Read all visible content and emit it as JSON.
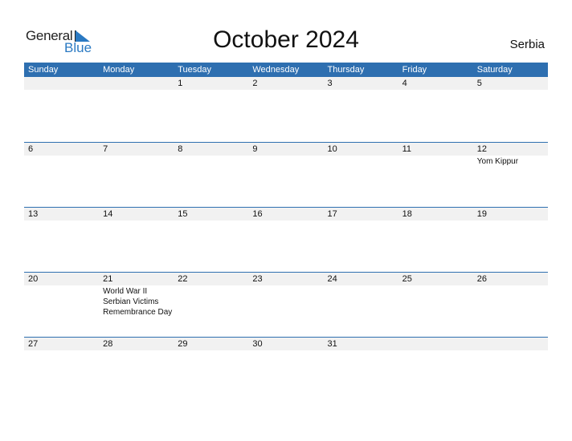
{
  "logo": {
    "general": "General",
    "blue": "Blue",
    "accent": "#2a79c2"
  },
  "title": "October 2024",
  "country": "Serbia",
  "header_color": "#2e6fb0",
  "weekdays": [
    "Sunday",
    "Monday",
    "Tuesday",
    "Wednesday",
    "Thursday",
    "Friday",
    "Saturday"
  ],
  "weeks": [
    {
      "days": [
        {
          "d": "",
          "e": ""
        },
        {
          "d": "",
          "e": ""
        },
        {
          "d": "1",
          "e": ""
        },
        {
          "d": "2",
          "e": ""
        },
        {
          "d": "3",
          "e": ""
        },
        {
          "d": "4",
          "e": ""
        },
        {
          "d": "5",
          "e": ""
        }
      ]
    },
    {
      "days": [
        {
          "d": "6",
          "e": ""
        },
        {
          "d": "7",
          "e": ""
        },
        {
          "d": "8",
          "e": ""
        },
        {
          "d": "9",
          "e": ""
        },
        {
          "d": "10",
          "e": ""
        },
        {
          "d": "11",
          "e": ""
        },
        {
          "d": "12",
          "e": "Yom Kippur"
        }
      ]
    },
    {
      "days": [
        {
          "d": "13",
          "e": ""
        },
        {
          "d": "14",
          "e": ""
        },
        {
          "d": "15",
          "e": ""
        },
        {
          "d": "16",
          "e": ""
        },
        {
          "d": "17",
          "e": ""
        },
        {
          "d": "18",
          "e": ""
        },
        {
          "d": "19",
          "e": ""
        }
      ]
    },
    {
      "days": [
        {
          "d": "20",
          "e": ""
        },
        {
          "d": "21",
          "e": "World War II Serbian Victims Remembrance Day"
        },
        {
          "d": "22",
          "e": ""
        },
        {
          "d": "23",
          "e": ""
        },
        {
          "d": "24",
          "e": ""
        },
        {
          "d": "25",
          "e": ""
        },
        {
          "d": "26",
          "e": ""
        }
      ]
    },
    {
      "days": [
        {
          "d": "27",
          "e": ""
        },
        {
          "d": "28",
          "e": ""
        },
        {
          "d": "29",
          "e": ""
        },
        {
          "d": "30",
          "e": ""
        },
        {
          "d": "31",
          "e": ""
        },
        {
          "d": "",
          "e": ""
        },
        {
          "d": "",
          "e": ""
        }
      ]
    }
  ]
}
